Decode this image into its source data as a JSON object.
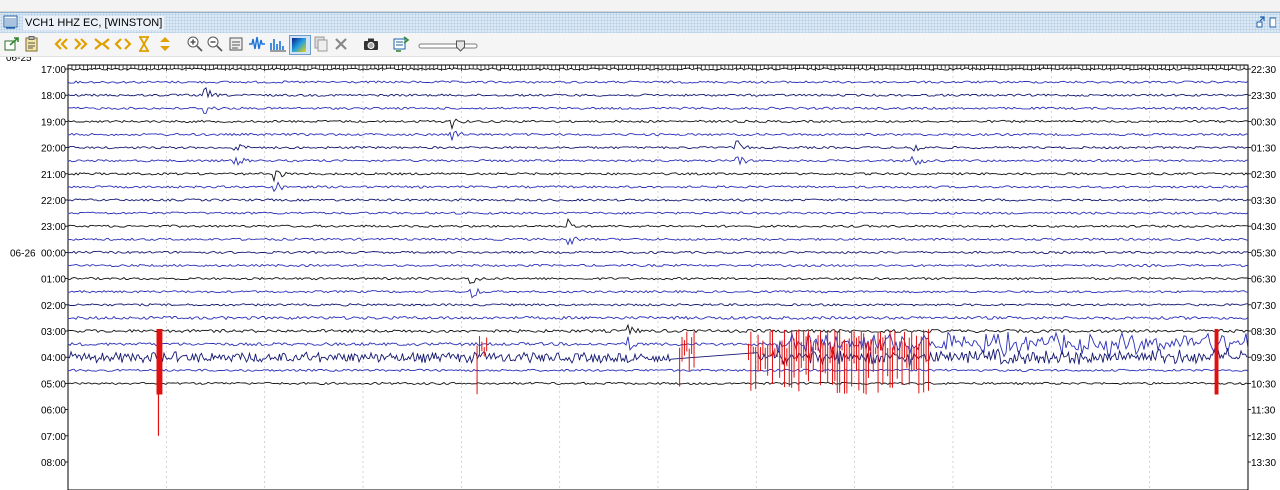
{
  "window": {
    "title": "VCH1 HHZ EC, [WINSTON]"
  },
  "toolbar": {
    "buttons": [
      {
        "name": "export-icon"
      },
      {
        "name": "clipboard-icon"
      },
      {
        "name": "scroll-back-icon"
      },
      {
        "name": "scroll-forward-icon"
      },
      {
        "name": "compress-x-icon"
      },
      {
        "name": "expand-x-icon"
      },
      {
        "name": "hourglass-icon"
      },
      {
        "name": "refresh-icon"
      },
      {
        "name": "zoom-in-icon"
      },
      {
        "name": "zoom-out-icon"
      },
      {
        "name": "waveform-view-icon"
      },
      {
        "name": "waveform-icon"
      },
      {
        "name": "spectra-icon"
      },
      {
        "name": "spectrogram-icon"
      },
      {
        "name": "copy-icon"
      },
      {
        "name": "close-icon"
      },
      {
        "name": "camera-icon"
      },
      {
        "name": "sync-icon"
      }
    ],
    "slider": {
      "name": "clipping-slider",
      "value": 0.75
    }
  },
  "helicorder": {
    "left_labels": [
      {
        "date": "06-25",
        "time": "17:00"
      },
      {
        "date": "",
        "time": "18:00"
      },
      {
        "date": "",
        "time": "19:00"
      },
      {
        "date": "",
        "time": "20:00"
      },
      {
        "date": "",
        "time": "21:00"
      },
      {
        "date": "",
        "time": "22:00"
      },
      {
        "date": "",
        "time": "23:00"
      },
      {
        "date": "06-26",
        "time": "00:00"
      },
      {
        "date": "",
        "time": "01:00"
      },
      {
        "date": "",
        "time": "02:00"
      },
      {
        "date": "",
        "time": "03:00"
      },
      {
        "date": "",
        "time": "04:00"
      },
      {
        "date": "",
        "time": "05:00"
      },
      {
        "date": "",
        "time": "06:00"
      },
      {
        "date": "",
        "time": "07:00"
      },
      {
        "date": "",
        "time": "08:00"
      }
    ],
    "right_labels": [
      "22:30",
      "23:30",
      "00:30",
      "01:30",
      "02:30",
      "03:30",
      "04:30",
      "05:30",
      "06:30",
      "07:30",
      "08:30",
      "09:30",
      "10:30",
      "11:30",
      "12:30",
      "13:30"
    ],
    "colors": {
      "trace_blue": "#2b2fb8",
      "trace_dark": "#141870",
      "trace_black": "#111111",
      "clip_red": "#e01010",
      "grid": "#c8c8c8"
    },
    "events": [
      {
        "hour_row": 1,
        "minute": 7
      },
      {
        "hour_row": 2,
        "minute": 19.5
      },
      {
        "hour_row": 3,
        "minute": 8.5
      },
      {
        "hour_row": 3,
        "minute": 34
      },
      {
        "hour_row": 3,
        "minute": 43
      },
      {
        "hour_row": 4,
        "minute": 10.5
      },
      {
        "hour_row": 6,
        "minute": 25.5
      },
      {
        "hour_row": 8,
        "minute": 20.5
      },
      {
        "hour_row": 10,
        "minute": 28.5
      }
    ],
    "clipped_segments": [
      {
        "hour_row": 11,
        "start_minute": 4.5,
        "end_minute": 4.8
      },
      {
        "hour_row": 10,
        "start_minute": 20.8,
        "end_minute": 21.4
      },
      {
        "hour_row": 10,
        "start_minute": 31.1,
        "end_minute": 31.9
      },
      {
        "hour_row": 10,
        "start_minute": 34.6,
        "end_minute": 43.8
      },
      {
        "hour_row": 10,
        "start_minute": 58.3,
        "end_minute": 58.5
      }
    ]
  }
}
